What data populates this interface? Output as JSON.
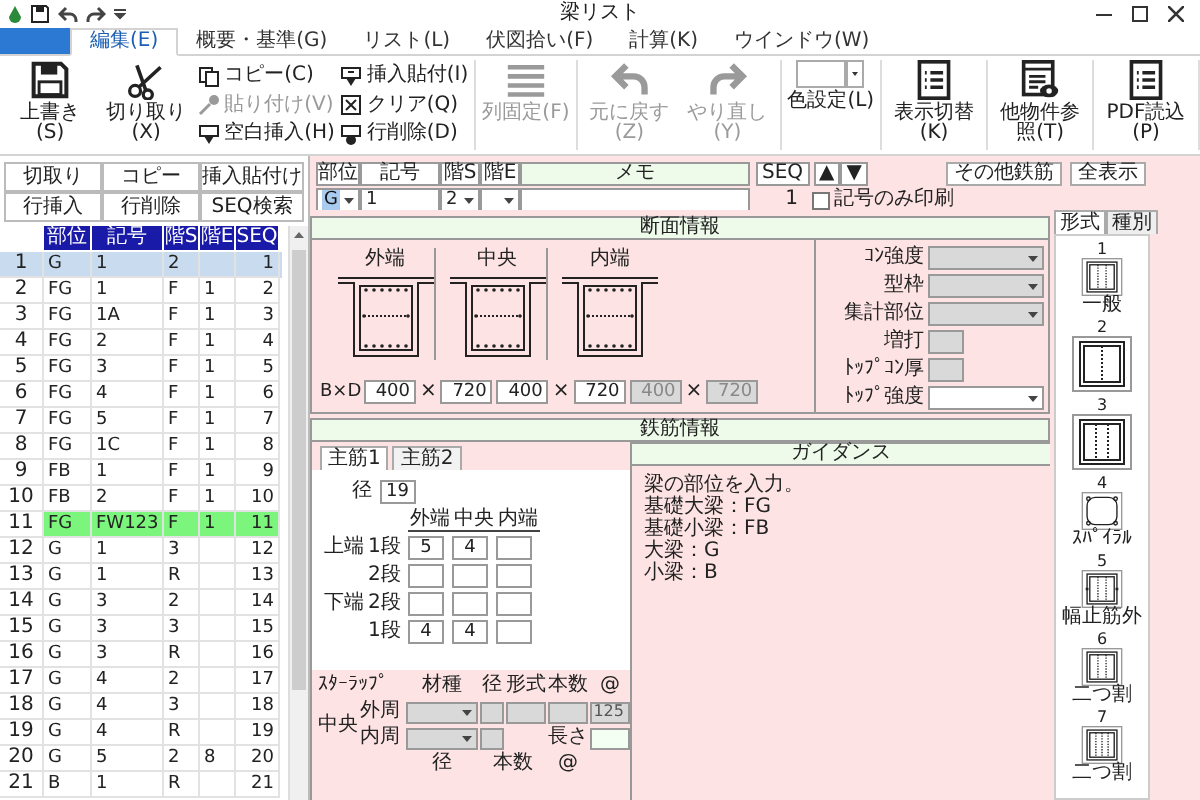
{
  "window": {
    "title": "梁リスト"
  },
  "menu_tabs": [
    {
      "label": "編集(E)",
      "selected": true
    },
    {
      "label": "概要・基準(G)",
      "selected": false
    },
    {
      "label": "リスト(L)",
      "selected": false
    },
    {
      "label": "伏図拾い(F)",
      "selected": false
    },
    {
      "label": "計算(K)",
      "selected": false
    },
    {
      "label": "ウインドウ(W)",
      "selected": false
    }
  ],
  "ribbon": {
    "groups": [
      {
        "items": [
          {
            "kind": "large",
            "label": "上書き(S)",
            "disabled": false
          },
          {
            "kind": "large",
            "label": "切り取り(X)",
            "disabled": false
          },
          {
            "kind": "small",
            "label": "コピー(C)",
            "disabled": false
          },
          {
            "kind": "small",
            "label": "貼り付け(V)",
            "disabled": true
          },
          {
            "kind": "small",
            "label": "空白挿入(H)",
            "disabled": false
          },
          {
            "kind": "small",
            "label": "挿入貼付(I)",
            "disabled": false
          },
          {
            "kind": "small",
            "label": "クリア(Q)",
            "disabled": false
          },
          {
            "kind": "small",
            "label": "行削除(D)",
            "disabled": false
          }
        ]
      },
      {
        "items": [
          {
            "kind": "large",
            "label": "列固定(F)",
            "disabled": true
          }
        ]
      },
      {
        "items": [
          {
            "kind": "large",
            "label": "元に戻す(Z)",
            "disabled": true
          },
          {
            "kind": "large",
            "label": "やり直し(Y)",
            "disabled": true
          }
        ]
      },
      {
        "items": [
          {
            "kind": "combo",
            "label": "色設定(L)",
            "disabled": false
          }
        ]
      },
      {
        "items": [
          {
            "kind": "large",
            "label": "表示切替(K)",
            "disabled": false
          }
        ]
      },
      {
        "items": [
          {
            "kind": "large",
            "label": "他物件参照(T)",
            "disabled": false
          }
        ]
      },
      {
        "items": [
          {
            "kind": "large",
            "label": "PDF読込(P)",
            "disabled": false
          }
        ]
      }
    ]
  },
  "list_panel": {
    "buttons": [
      "切取り",
      "コピー",
      "挿入貼付け",
      "行挿入",
      "行削除",
      "SEQ検索"
    ],
    "table": {
      "columns": [
        "部位",
        "記号",
        "階S",
        "階E",
        "SEQ"
      ],
      "rows": [
        {
          "no": "1",
          "cells": [
            "G",
            "1",
            "2",
            null,
            "1"
          ],
          "selected": true,
          "highlighted": false
        },
        {
          "no": "2",
          "cells": [
            "FG",
            "1",
            "F",
            "1",
            "2"
          ],
          "selected": false,
          "highlighted": false
        },
        {
          "no": "3",
          "cells": [
            "FG",
            "1A",
            "F",
            "1",
            "3"
          ],
          "selected": false,
          "highlighted": false
        },
        {
          "no": "4",
          "cells": [
            "FG",
            "2",
            "F",
            "1",
            "4"
          ],
          "selected": false,
          "highlighted": false
        },
        {
          "no": "5",
          "cells": [
            "FG",
            "3",
            "F",
            "1",
            "5"
          ],
          "selected": false,
          "highlighted": false
        },
        {
          "no": "6",
          "cells": [
            "FG",
            "4",
            "F",
            "1",
            "6"
          ],
          "selected": false,
          "highlighted": false
        },
        {
          "no": "7",
          "cells": [
            "FG",
            "5",
            "F",
            "1",
            "7"
          ],
          "selected": false,
          "highlighted": false
        },
        {
          "no": "8",
          "cells": [
            "FG",
            "1C",
            "F",
            "1",
            "8"
          ],
          "selected": false,
          "highlighted": false
        },
        {
          "no": "9",
          "cells": [
            "FB",
            "1",
            "F",
            "1",
            "9"
          ],
          "selected": false,
          "highlighted": false
        },
        {
          "no": "10",
          "cells": [
            "FB",
            "2",
            "F",
            "1",
            "10"
          ],
          "selected": false,
          "highlighted": false
        },
        {
          "no": "11",
          "cells": [
            "FG",
            "FW123",
            "F",
            "1",
            "11"
          ],
          "selected": false,
          "highlighted": true
        },
        {
          "no": "12",
          "cells": [
            "G",
            "1",
            "3",
            null,
            "12"
          ],
          "selected": false,
          "highlighted": false
        },
        {
          "no": "13",
          "cells": [
            "G",
            "1",
            "R",
            null,
            "13"
          ],
          "selected": false,
          "highlighted": false
        },
        {
          "no": "14",
          "cells": [
            "G",
            "3",
            "2",
            null,
            "14"
          ],
          "selected": false,
          "highlighted": false
        },
        {
          "no": "15",
          "cells": [
            "G",
            "3",
            "3",
            null,
            "15"
          ],
          "selected": false,
          "highlighted": false
        },
        {
          "no": "16",
          "cells": [
            "G",
            "3",
            "R",
            null,
            "16"
          ],
          "selected": false,
          "highlighted": false
        },
        {
          "no": "17",
          "cells": [
            "G",
            "4",
            "2",
            null,
            "17"
          ],
          "selected": false,
          "highlighted": false
        },
        {
          "no": "18",
          "cells": [
            "G",
            "4",
            "3",
            null,
            "18"
          ],
          "selected": false,
          "highlighted": false
        },
        {
          "no": "19",
          "cells": [
            "G",
            "4",
            "R",
            null,
            "19"
          ],
          "selected": false,
          "highlighted": false
        },
        {
          "no": "20",
          "cells": [
            "G",
            "5",
            "2",
            "8",
            "20"
          ],
          "selected": false,
          "highlighted": false
        },
        {
          "no": "21",
          "cells": [
            "B",
            "1",
            "R",
            null,
            "21"
          ],
          "selected": false,
          "highlighted": false
        }
      ]
    }
  },
  "record": {
    "fields": [
      {
        "label": "部位",
        "kind": "combo",
        "value": "G"
      },
      {
        "label": "記号",
        "kind": "text",
        "value": "1"
      },
      {
        "label": "階S",
        "kind": "combo",
        "value": "2"
      },
      {
        "label": "階E",
        "kind": "combo"
      },
      {
        "label": "メモ",
        "kind": "text"
      }
    ],
    "seq": {
      "label": "SEQ",
      "value": "1"
    },
    "up": "▲",
    "down": "▼",
    "print_symbol_only": {
      "label": "記号のみ印刷",
      "checked": false
    },
    "buttons": [
      "その他鉄筋",
      "全表示"
    ]
  },
  "section": {
    "title": "断面情報",
    "positions": [
      "外端",
      "中央",
      "内端"
    ],
    "bd": {
      "label": "B×D",
      "times": "×",
      "dims": [
        {
          "b": "400",
          "d": "720",
          "disabled": false
        },
        {
          "b": "400",
          "d": "720",
          "disabled": false
        },
        {
          "b": "400",
          "d": "720",
          "disabled": true
        }
      ]
    },
    "fields": [
      {
        "label": "ｺﾝ強度",
        "kind": "combo",
        "disabled": true
      },
      {
        "label": "型枠",
        "kind": "combo",
        "disabled": true
      },
      {
        "label": "集計部位",
        "kind": "combo",
        "disabled": true
      },
      {
        "label": "増打",
        "kind": "box",
        "disabled": true
      },
      {
        "label": "ﾄｯﾌﾟｺﾝ厚",
        "kind": "box",
        "disabled": true
      },
      {
        "label": "ﾄｯﾌﾟ強度",
        "kind": "combo",
        "disabled": false
      }
    ]
  },
  "rebar": {
    "title": "鉄筋情報",
    "tabs": [
      {
        "label": "主筋1",
        "selected": true
      },
      {
        "label": "主筋2",
        "selected": false
      }
    ],
    "diameter": {
      "label": "径",
      "value": "19"
    },
    "columns": [
      "外端",
      "中央",
      "内端"
    ],
    "rows": [
      {
        "group": "上端",
        "level": "1段",
        "values": {
          "outer": "5",
          "center": "4"
        }
      },
      {
        "level": "2段"
      },
      {
        "group": "下端",
        "level": "2段"
      },
      {
        "level": "1段",
        "values": {
          "outer": "4",
          "center": "4"
        }
      }
    ],
    "stirrup": {
      "title": "ｽﾀｰﾗｯﾌﾟ",
      "headers": [
        "材種",
        "径",
        "形式",
        "本数",
        "@"
      ],
      "group": "中央",
      "outer": {
        "label": "外周",
        "pitch": "125"
      },
      "inner": {
        "label": "内周",
        "length_label": "長さ"
      },
      "sub_headers": [
        "径",
        "本数",
        "@"
      ]
    }
  },
  "guidance": {
    "title": "ガイダンス",
    "lines": [
      "梁の部位を入力。",
      "基礎大梁：FG",
      "基礎小梁：FB",
      "大梁：G",
      "小梁：B"
    ]
  },
  "form_panel": {
    "tabs": [
      {
        "label": "形式",
        "selected": true
      },
      {
        "label": "種別",
        "selected": false
      }
    ],
    "items": [
      {
        "no": "1",
        "label": "一般"
      },
      {
        "no": "2"
      },
      {
        "no": "3"
      },
      {
        "no": "4",
        "label": "ｽﾊﾟｲﾗﾙ"
      },
      {
        "no": "5",
        "label": "幅止筋外"
      },
      {
        "no": "6",
        "label": "二つ割"
      },
      {
        "no": "7",
        "label": "二つ割"
      }
    ]
  }
}
